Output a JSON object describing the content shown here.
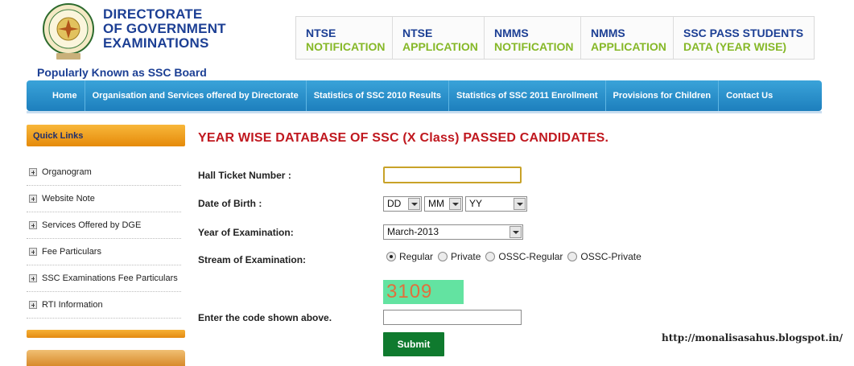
{
  "header": {
    "org_line1": "DIRECTORATE",
    "org_line2": "OF GOVERNMENT",
    "org_line3": "EXAMINATIONS",
    "tagline": "Popularly Known as SSC Board",
    "seal_icon": "government-seal-icon"
  },
  "notifications": [
    {
      "line1": "NTSE",
      "line2": "NOTIFICATION"
    },
    {
      "line1": "NTSE",
      "line2": "APPLICATION"
    },
    {
      "line1": "NMMS",
      "line2": "NOTIFICATION"
    },
    {
      "line1": "NMMS",
      "line2": "APPLICATION"
    },
    {
      "line1": "SSC PASS STUDENTS",
      "line2": "DATA (YEAR WISE)"
    }
  ],
  "nav": [
    "Home",
    "Organisation and Services offered by Directorate",
    "Statistics of SSC 2010 Results",
    "Statistics of SSC 2011 Enrollment",
    "Provisions for Children",
    "Contact Us"
  ],
  "sidebar": {
    "header": "Quick Links",
    "items": [
      "Organogram",
      "Website Note",
      "Services Offered by DGE",
      "Fee Particulars",
      "SSC Examinations Fee Particulars",
      "RTI Information"
    ]
  },
  "form": {
    "title": "YEAR WISE DATABASE OF SSC (X Class) PASSED CANDIDATES.",
    "hall_label": "Hall Ticket Number :",
    "hall_value": "",
    "dob_label": "Date of Birth :",
    "dob_day": "DD",
    "dob_month": "MM",
    "dob_year": "YY",
    "year_label": "Year of Examination:",
    "year_value": "March-2013",
    "stream_label": "Stream of Examination:",
    "streams": [
      "Regular",
      "Private",
      "OSSC-Regular",
      "OSSC-Private"
    ],
    "captcha": "3109",
    "code_label": "Enter the code shown above.",
    "code_value": "",
    "submit_label": "Submit"
  },
  "watermark": "http://monalisasahus.blogspot.in/",
  "colors": {
    "brand_blue": "#1c3f94",
    "accent_green": "#86b828",
    "title_red": "#c0181f",
    "nav_blue": "#1d7fbd",
    "quicklinks_orange": "#e58a0a",
    "submit_green": "#0f7a2e",
    "captcha_bg": "#63e3a1"
  }
}
